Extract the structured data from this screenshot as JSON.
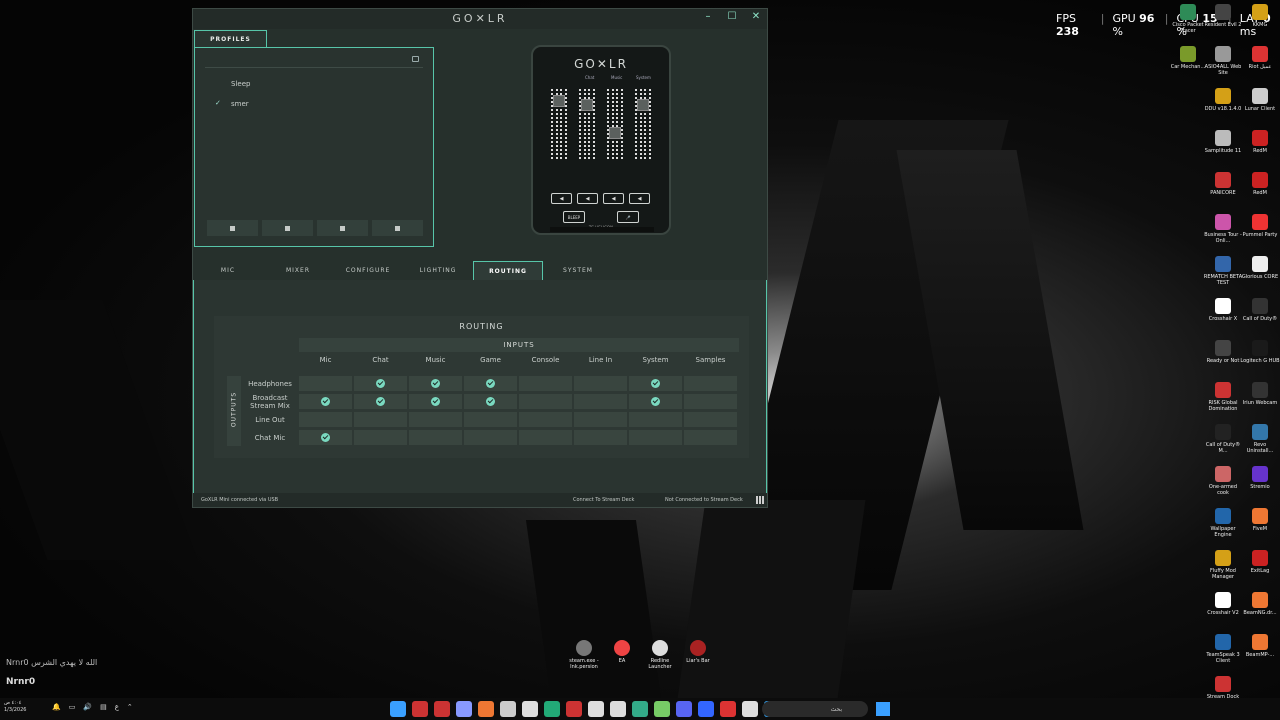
{
  "overlay": {
    "fps_label": "FPS",
    "fps_value": "238",
    "gpu_label": "GPU",
    "gpu_value": "96",
    "gpu_unit": "%",
    "cpu_label": "CPU",
    "cpu_value": "15",
    "cpu_unit": "%",
    "lat_label": "LAT",
    "lat_value": "0",
    "lat_unit": "ms"
  },
  "app": {
    "title": "GO✕LR",
    "minimize": "–",
    "maximize": "☐",
    "close": "✕",
    "profiles_tab": "PROFILES",
    "profiles": [
      {
        "name": "Sleep",
        "active": false
      },
      {
        "name": "smer",
        "active": true
      }
    ],
    "active_check": "✓",
    "device": {
      "logo": "GO✕LR",
      "logo_sub": "mini",
      "channel_labels": [
        "Chat",
        "Music",
        "System"
      ],
      "fx_labels": [
        "BLEEP",
        "🎤"
      ],
      "brand": "TC·HELICON"
    },
    "tabs": [
      "MIC",
      "MIXER",
      "CONFIGURE",
      "LIGHTING",
      "ROUTING",
      "SYSTEM"
    ],
    "active_tab": "ROUTING",
    "routing": {
      "title": "ROUTING",
      "inputs_label": "INPUTS",
      "outputs_label": "OUTPUTS",
      "inputs": [
        "Mic",
        "Chat",
        "Music",
        "Game",
        "Console",
        "Line In",
        "System",
        "Samples"
      ],
      "outputs": [
        "Headphones",
        "Broadcast Stream Mix",
        "Line Out",
        "Chat Mic"
      ],
      "matrix": [
        [
          false,
          true,
          true,
          true,
          false,
          false,
          true,
          false
        ],
        [
          true,
          true,
          true,
          true,
          false,
          false,
          true,
          false
        ],
        [
          false,
          false,
          false,
          false,
          false,
          false,
          false,
          false
        ],
        [
          true,
          false,
          false,
          false,
          false,
          false,
          false,
          false
        ]
      ]
    },
    "status": {
      "connection": "GoXLR Mini connected via USB",
      "stream_deck_link": "Connect To Stream Deck",
      "stream_deck_status": "Not Connected to Stream Deck"
    }
  },
  "desktop_icons_right": [
    {
      "label": "Cisco Packet Tracer",
      "color": "#2e8b57"
    },
    {
      "label": "Resident Evil 2",
      "color": "#444"
    },
    {
      "label": "KKMG",
      "color": "#d4a017"
    },
    {
      "label": "Car Mechan...",
      "color": "#7a9a2a"
    },
    {
      "label": "ASIO4ALL Web Site",
      "color": "#999"
    },
    {
      "label": "Riot عميل",
      "color": "#d33"
    },
    {
      "label": "DDU v18.1.4.0",
      "color": "#d4a017"
    },
    {
      "label": "Lunar Client",
      "color": "#ccc"
    },
    {
      "label": "Samplitude 11",
      "color": "#bbb"
    },
    {
      "label": "RedM",
      "color": "#c22"
    },
    {
      "label": "PANICORE",
      "color": "#c33"
    },
    {
      "label": "RedM",
      "color": "#c22"
    },
    {
      "label": "Business Tour - Onli...",
      "color": "#c5a"
    },
    {
      "label": "Pummel Party",
      "color": "#e33"
    },
    {
      "label": "REMATCH BETA TEST",
      "color": "#36a"
    },
    {
      "label": "Glorious CORE",
      "color": "#eee"
    },
    {
      "label": "Crosshair X",
      "color": "#fff"
    },
    {
      "label": "Call of Duty®",
      "color": "#333"
    },
    {
      "label": "Ready or Not",
      "color": "#444"
    },
    {
      "label": "Logitech G HUB",
      "color": "#1a1a1a"
    },
    {
      "label": "RISK Global Domination",
      "color": "#c33"
    },
    {
      "label": "Iriun Webcam",
      "color": "#333"
    },
    {
      "label": "Call of Duty® M...",
      "color": "#222"
    },
    {
      "label": "Revo Uninstall...",
      "color": "#37a"
    },
    {
      "label": "One-armed cook",
      "color": "#c66"
    },
    {
      "label": "Stremio",
      "color": "#63c"
    },
    {
      "label": "Wallpaper Engine",
      "color": "#26a"
    },
    {
      "label": "FiveM",
      "color": "#e73"
    },
    {
      "label": "Fluffy Mod Manager",
      "color": "#d4a017"
    },
    {
      "label": "ExitLag",
      "color": "#c22"
    },
    {
      "label": "Crosshair V2",
      "color": "#fff"
    },
    {
      "label": "BeamNG.dr...",
      "color": "#e73"
    },
    {
      "label": "TeamSpeak 3 Client",
      "color": "#26a"
    },
    {
      "label": "BeamMP-...",
      "color": "#e73"
    },
    {
      "label": "Stream Dock AJAZZ",
      "color": "#c33"
    }
  ],
  "desktop_icons_center": [
    {
      "label": "steam.exe - Ink.persion",
      "color": "#777"
    },
    {
      "label": "EA",
      "color": "#e44"
    },
    {
      "label": "Redline Launcher",
      "color": "#ddd"
    },
    {
      "label": "Liar's Bar",
      "color": "#a22"
    }
  ],
  "chat": {
    "line1": "Nrnr0 الله لا يهدي الشرس",
    "name": "Nrnr0"
  },
  "taskbar": {
    "time": "٤:٠٤ ص",
    "date": "1/3/2026",
    "lang": "ع",
    "search_placeholder": "بحث",
    "app_colors": [
      "#3aa0ff",
      "#c33",
      "#c33",
      "#8899ff",
      "#e73",
      "#ccc",
      "#ddd",
      "#2a7",
      "#c33",
      "#ddd",
      "#ddd",
      "#3a8",
      "#7c6",
      "#5865f2",
      "#36f",
      "#d33",
      "#ddd",
      "#3af",
      "#e8b",
      "#fff"
    ]
  }
}
